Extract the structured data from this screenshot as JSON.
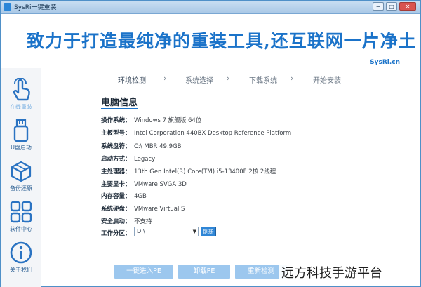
{
  "window": {
    "title": "SysRi一键重装",
    "minimize_label": "−",
    "restore_label": "□",
    "close_label": "✕"
  },
  "banner": {
    "slogan": "致力于打造最纯净的重装工具,还互联网一片净土",
    "brand": "SysRi.cn"
  },
  "sidebar": {
    "items": [
      {
        "label": "在线重装",
        "icon": "hand-pointer-icon",
        "active": true
      },
      {
        "label": "U盘启动",
        "icon": "usb-drive-icon"
      },
      {
        "label": "备份还原",
        "icon": "box-icon"
      },
      {
        "label": "软件中心",
        "icon": "apps-grid-icon"
      },
      {
        "label": "关于我们",
        "icon": "info-icon"
      }
    ]
  },
  "steps": [
    {
      "label": "环境检测",
      "active": true
    },
    {
      "label": "系统选择"
    },
    {
      "label": "下载系统"
    },
    {
      "label": "开始安装"
    }
  ],
  "panel": {
    "title": "电脑信息",
    "rows": [
      {
        "label": "操作系统：",
        "value": "Windows 7 旗舰版   64位"
      },
      {
        "label": "主板型号：",
        "value": "Intel Corporation 440BX Desktop Reference Platform"
      },
      {
        "label": "系统盘符：",
        "value": "C:\\  MBR 49.9GB"
      },
      {
        "label": "启动方式：",
        "value": "Legacy"
      },
      {
        "label": "主处理器：",
        "value": "13th Gen Intel(R) Core(TM) i5-13400F 2核 2线程"
      },
      {
        "label": "主要显卡：",
        "value": "VMware SVGA 3D"
      },
      {
        "label": "内存容量：",
        "value": "4GB"
      },
      {
        "label": "系统硬盘：",
        "value": "VMware Virtual S"
      },
      {
        "label": "安全启动：",
        "value": "不支持"
      }
    ],
    "partition_label": "工作分区：",
    "partition_value": "D:\\",
    "refresh_label": "刷新"
  },
  "actions": {
    "one_click_pe": "一键进入PE",
    "unload_pe": "卸载PE",
    "recheck": "重新检测"
  },
  "watermark": "远方科技手游平台"
}
